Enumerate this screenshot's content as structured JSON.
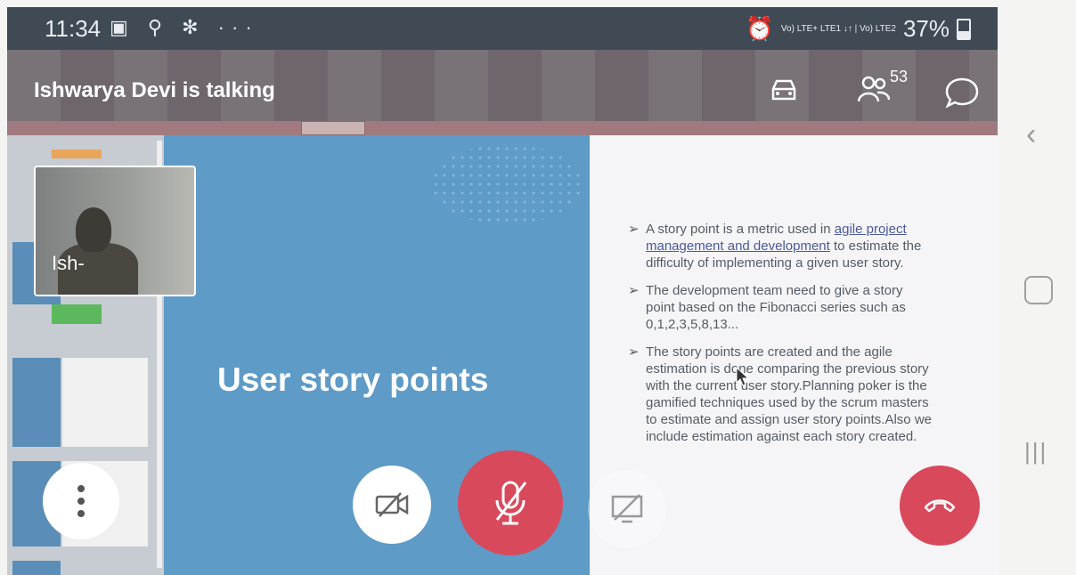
{
  "status_bar": {
    "time": "11:34",
    "battery": "37%",
    "network": "Vo) LTE+ LTE1 ↓↑ | Vo) LTE2"
  },
  "header": {
    "title": "Ishwarya Devi is talking",
    "participant_count": "53"
  },
  "self_video": {
    "name": "Ish-"
  },
  "slide": {
    "title": "User story points",
    "bullets": [
      {
        "pre": "A story point is a metric used in ",
        "link": "agile project management and development",
        "post": " to estimate the difficulty of implementing a given user story."
      },
      {
        "text": "The development team need to give a story point based on the Fibonacci series such as 0,1,2,3,5,8,13..."
      },
      {
        "text": "The story points are created and the agile estimation is done comparing the previous story with the current user story.Planning poker is the gamified techniques used by the scrum masters to estimate and assign user story points.Also we include estimation against each story created."
      }
    ]
  },
  "colors": {
    "accent_red": "#d9495c",
    "slide_blue": "#5e9bc7",
    "header": "#5f555a"
  }
}
